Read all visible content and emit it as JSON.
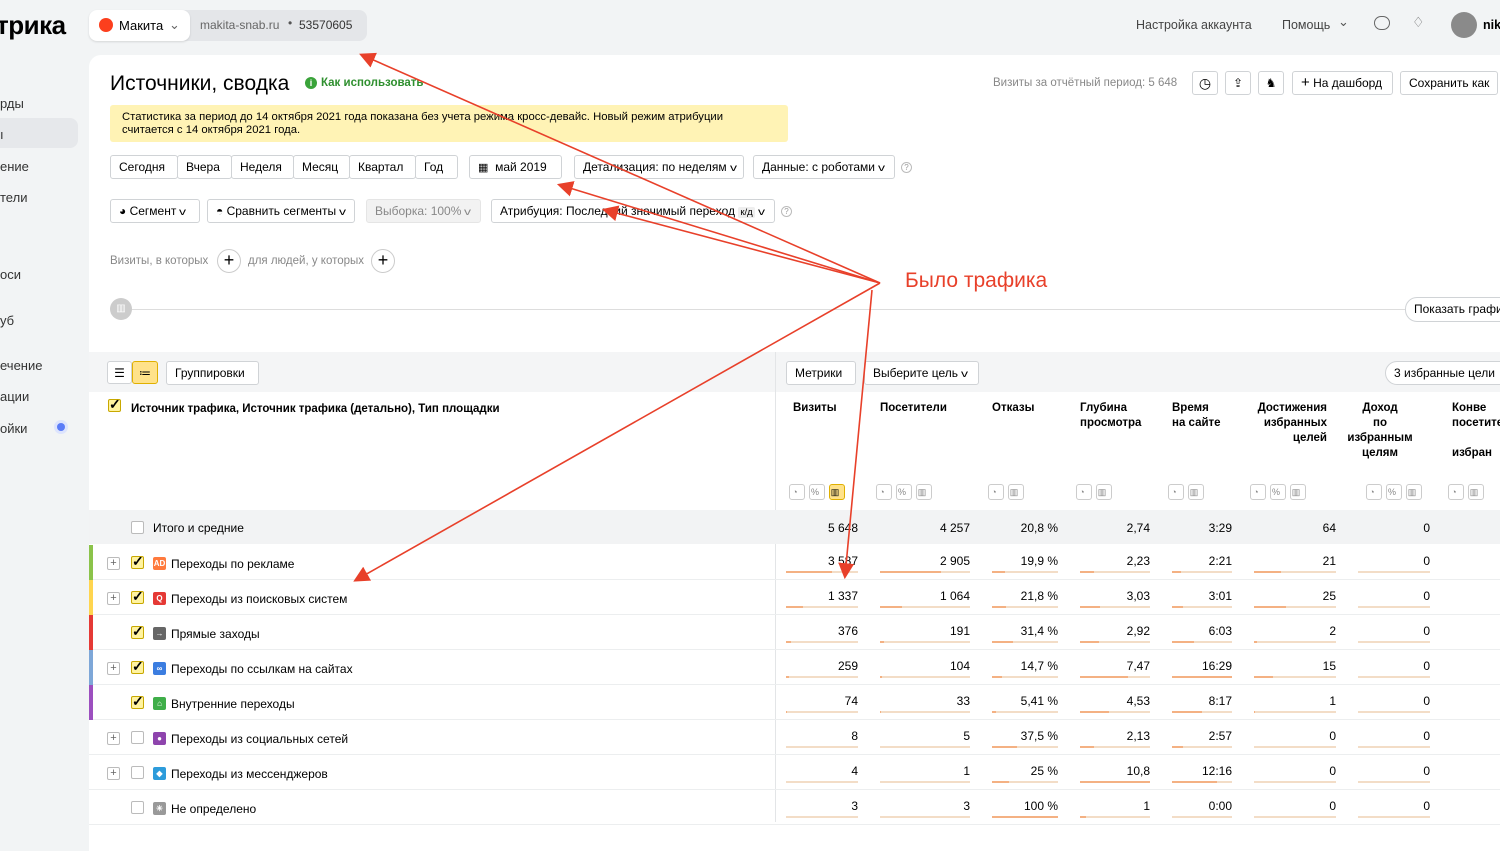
{
  "topbar": {
    "logo": "трика",
    "counter_name": "Макита",
    "counter_site": "makita-snab.ru",
    "counter_id": "53570605",
    "account_settings": "Настройка аккаунта",
    "help": "Помощь",
    "user": "nik"
  },
  "sidebar": {
    "items": [
      "рды",
      "ı",
      "ение",
      "тели",
      "оси",
      "уб",
      "ечение",
      "ации",
      "ойки"
    ]
  },
  "page": {
    "title": "Источники, сводка",
    "how_to": "Как использовать",
    "visits_period": "Визиты за отчётный период: 5 648",
    "to_dashboard": "На дашборд",
    "save_as": "Сохранить как",
    "notice_line1": "Статистика за период до 14 октября 2021 года показана без учета режима кросс-девайс. Новый режим атрибуции",
    "notice_line2": "считается с 14 октября 2021 года."
  },
  "periods": [
    "Сегодня",
    "Вчера",
    "Неделя",
    "Месяц",
    "Квартал",
    "Год"
  ],
  "filters": {
    "date": "май 2019",
    "detail": "Детализация: по неделям",
    "data": "Данные: с роботами",
    "segment": "Сегмент",
    "compare": "Сравнить сегменты",
    "sample": "Выборка: 100%",
    "attribution": "Атрибуция: Последний значимый переход",
    "attribution_badge": "к/д",
    "visits_where": "Визиты, в которых",
    "people_where": "для людей, у которых",
    "show_chart": "Показать графи"
  },
  "annotation": {
    "text": "Было трафика",
    "color": "#e8402a"
  },
  "table": {
    "groupings": "Группировки",
    "metrics": "Метрики",
    "choose_goal": "Выберите цель",
    "favorite_goals": "3 избранные цели",
    "dimension_header": "Источник трафика, Источник трафика (детально), Тип площадки",
    "columns": [
      {
        "l1": "Визиты",
        "l2": "",
        "l3": "",
        "l4": ""
      },
      {
        "l1": "Посетители",
        "l2": "",
        "l3": "",
        "l4": ""
      },
      {
        "l1": "Отказы",
        "l2": "",
        "l3": "",
        "l4": ""
      },
      {
        "l1": "Глубина",
        "l2": "просмотра",
        "l3": "",
        "l4": ""
      },
      {
        "l1": "Время",
        "l2": "на сайте",
        "l3": "",
        "l4": ""
      },
      {
        "l1": "Достижения",
        "l2": "избранных",
        "l3": "целей",
        "l4": ""
      },
      {
        "l1": "Доход",
        "l2": "по",
        "l3": "избранным",
        "l4": "целям"
      },
      {
        "l1": "Конве",
        "l2": "посетите",
        "l3": "",
        "l4": "избран"
      }
    ],
    "total_label": "Итого и средние",
    "total": [
      "5 648",
      "4 257",
      "20,8 %",
      "2,74",
      "3:29",
      "64",
      "0"
    ],
    "rows": [
      {
        "label": "Переходы по рекламе",
        "values": [
          "3 587",
          "2 905",
          "19,9 %",
          "2,23",
          "2:21",
          "21",
          "0"
        ],
        "color": "#8bc34a",
        "icon": "AD",
        "icon_color": "#ff7a3d",
        "expandable": true,
        "checked": true
      },
      {
        "label": "Переходы из поисковых систем",
        "values": [
          "1 337",
          "1 064",
          "21,8 %",
          "3,03",
          "3:01",
          "25",
          "0"
        ],
        "color": "#ffd54f",
        "icon": "Q",
        "icon_color": "#e53935",
        "expandable": true,
        "checked": true
      },
      {
        "label": "Прямые заходы",
        "values": [
          "376",
          "191",
          "31,4 %",
          "2,92",
          "6:03",
          "2",
          "0"
        ],
        "color": "#e53935",
        "icon": "→",
        "icon_color": "#666666",
        "expandable": false,
        "checked": true
      },
      {
        "label": "Переходы по ссылкам на сайтах",
        "values": [
          "259",
          "104",
          "14,7 %",
          "7,47",
          "16:29",
          "15",
          "0"
        ],
        "color": "#7ea7d8",
        "icon": "∞",
        "icon_color": "#3b7de0",
        "expandable": true,
        "checked": true
      },
      {
        "label": "Внутренние переходы",
        "values": [
          "74",
          "33",
          "5,41 %",
          "4,53",
          "8:17",
          "1",
          "0"
        ],
        "color": "#9c4fbf",
        "icon": "⌂",
        "icon_color": "#3fae49",
        "expandable": false,
        "checked": true
      },
      {
        "label": "Переходы из социальных сетей",
        "values": [
          "8",
          "5",
          "37,5 %",
          "2,13",
          "2:57",
          "0",
          "0"
        ],
        "color": "",
        "icon": "●",
        "icon_color": "#8e44ad",
        "expandable": true,
        "checked": false
      },
      {
        "label": "Переходы из мессенджеров",
        "values": [
          "4",
          "1",
          "25 %",
          "10,8",
          "12:16",
          "0",
          "0"
        ],
        "color": "",
        "icon": "◆",
        "icon_color": "#2d9cdb",
        "expandable": true,
        "checked": false
      },
      {
        "label": "Не определено",
        "values": [
          "3",
          "3",
          "100 %",
          "1",
          "0:00",
          "0",
          "0"
        ],
        "color": "",
        "icon": "✳",
        "icon_color": "#999999",
        "expandable": false,
        "checked": false
      }
    ]
  }
}
